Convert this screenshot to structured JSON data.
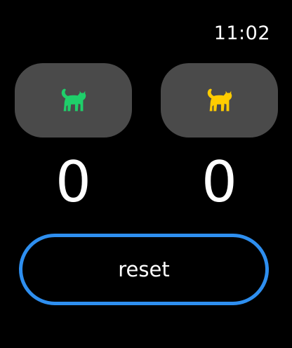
{
  "status_bar": {
    "time": "11:02"
  },
  "players": [
    {
      "icon": "cat-icon",
      "icon_color": "#1fcf6a",
      "score": "0"
    },
    {
      "icon": "cat-icon",
      "icon_color": "#ffcc00",
      "score": "0"
    }
  ],
  "reset": {
    "label": "reset",
    "border_color": "#2e8ff0"
  },
  "colors": {
    "background": "#000000",
    "button_fill": "#4a4a4a",
    "text": "#ffffff"
  }
}
